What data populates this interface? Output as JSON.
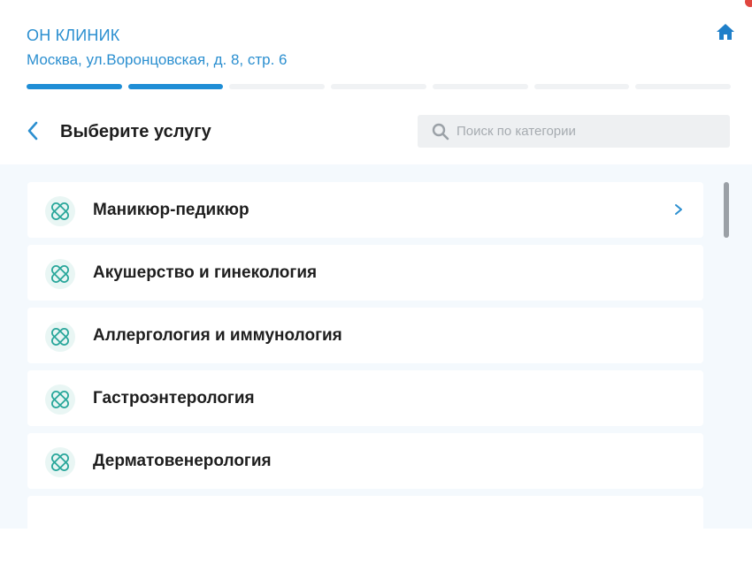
{
  "header": {
    "clinic_name": "ОН КЛИНИК",
    "clinic_address": "Москва, ул.Воронцовская, д. 8, стр. 6",
    "home_icon": "home-icon"
  },
  "progress": {
    "total_steps": 7,
    "completed_steps": 2,
    "accent_color": "#1f8ed6"
  },
  "toolbar": {
    "back_icon": "chevron-left-icon",
    "title": "Выберите услугу"
  },
  "search": {
    "placeholder": "Поиск по категории",
    "value": "",
    "icon": "search-icon"
  },
  "categories": [
    {
      "label": "Маникюр-педикюр",
      "icon": "bandage-icon",
      "chevron": true
    },
    {
      "label": "Акушерство и гинекология",
      "icon": "bandage-icon",
      "chevron": false
    },
    {
      "label": "Аллергология и иммунология",
      "icon": "bandage-icon",
      "chevron": false
    },
    {
      "label": "Гастроэнтерология",
      "icon": "bandage-icon",
      "chevron": false
    },
    {
      "label": "Дерматовенерология",
      "icon": "bandage-icon",
      "chevron": false
    },
    {
      "label": "",
      "icon": "",
      "chevron": false
    }
  ],
  "colors": {
    "brand_blue": "#2b8fd0",
    "list_background": "#f4f9fd",
    "icon_teal": "#2aa79b"
  }
}
